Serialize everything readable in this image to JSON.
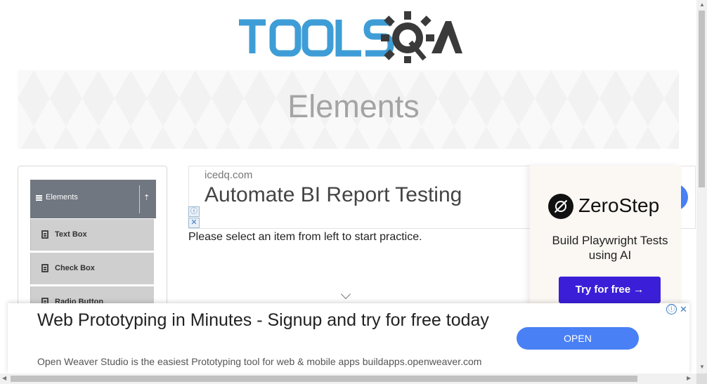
{
  "header": {
    "logo_text": "TOOLSQA"
  },
  "banner": {
    "title": "Elements"
  },
  "sidebar": {
    "group": {
      "label": "Elements",
      "icon": "menu-icon",
      "collapse_icon": "collapse-arrow-icon"
    },
    "items": [
      {
        "label": "Text Box",
        "icon": "doc-icon"
      },
      {
        "label": "Check Box",
        "icon": "doc-icon"
      },
      {
        "label": "Radio Button",
        "icon": "doc-icon"
      }
    ]
  },
  "main": {
    "instructions": "Please select an item from left to start practice."
  },
  "top_ad": {
    "domain": "icedq.com",
    "headline": "Automate BI Report Testing",
    "info_icon": "ⓘ",
    "close_icon": "✕"
  },
  "side_ad": {
    "brand": "ZeroStep",
    "tagline": "Build Playwright Tests using AI",
    "cta": "Try for free →"
  },
  "bottom_ad": {
    "headline": "Web Prototyping in Minutes - Signup and try for free today",
    "description": "Open Weaver Studio is the easiest Prototyping tool for web & mobile apps buildapps.openweaver.com",
    "button": "OPEN",
    "info_icon": "ⓘ",
    "close_icon": "✕"
  },
  "colors": {
    "logo_blue": "#3e9dd6",
    "logo_dark": "#3a3a3a",
    "sidebar_header": "#707780",
    "ad_blue": "#4a80f5",
    "zs_cta": "#3b1fd8"
  }
}
